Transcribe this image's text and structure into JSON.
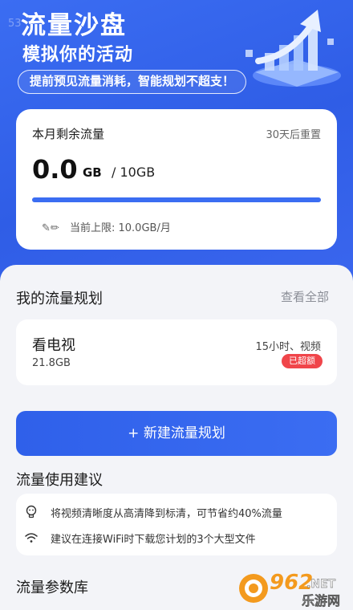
{
  "hero": {
    "faint_text": "53",
    "title": "流量沙盘",
    "subtitle": "模拟你的活动",
    "tagline": "提前预见流量消耗，智能规划不超支！"
  },
  "usage_card": {
    "label": "本月剩余流量",
    "reset_text": "30天后重置",
    "remaining_value": "0.0",
    "remaining_unit": "GB",
    "total_text": "/ 10GB",
    "usage_fraction": 1.0,
    "cap_icon_text": "✎✏",
    "cap_text": "当前上限: 10.0GB/月"
  },
  "plans_section": {
    "title": "我的流量规划",
    "see_all": "查看全部",
    "plan": {
      "name": "看电视",
      "size": "21.8GB",
      "meta": "15小时、视频",
      "badge": "已超额"
    }
  },
  "new_plan_button": "+ 新建流量规划",
  "suggestions": {
    "title": "流量使用建议",
    "items": [
      {
        "icon": "lightbulb-icon",
        "text": "将视频清晰度从高清降到标清，可节省约40%流量"
      },
      {
        "icon": "wifi-icon",
        "text": "建议在连接WiFi时下载您计划的3个大型文件"
      }
    ]
  },
  "params_section": {
    "title": "流量参数库"
  },
  "watermark": {
    "number": "962",
    "suffix": ".NET",
    "text": "乐游网"
  },
  "colors": {
    "primary": "#3b6df2",
    "danger": "#f0454a",
    "background": "#f3f4f8"
  }
}
